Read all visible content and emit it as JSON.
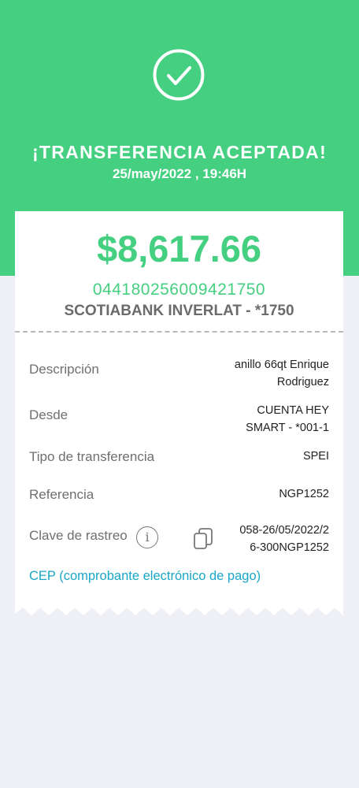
{
  "header": {
    "title": "¡TRANSFERENCIA ACEPTADA!",
    "datetime": "25/may/2022 , 19:46H",
    "icon": "check-circle-icon",
    "background_color": "#45cf80"
  },
  "receipt": {
    "amount": "$8,617.66",
    "account_number": "044180256009421750",
    "bank": "SCOTIABANK INVERLAT - *1750",
    "details": [
      {
        "label": "Descripción",
        "value_lines": [
          "anillo 66qt Enrique",
          "Rodriguez"
        ]
      },
      {
        "label": "Desde",
        "value_lines": [
          "CUENTA HEY",
          "SMART - *001-1"
        ]
      },
      {
        "label": "Tipo de transferencia",
        "value_lines": [
          "SPEI"
        ]
      },
      {
        "label": "Referencia",
        "value_lines": [
          "NGP1252"
        ]
      },
      {
        "label": "Clave de rastreo",
        "value_lines": [
          "058-26/05/2022/2",
          "6-300NGP1252"
        ]
      }
    ],
    "info_icon": "info-icon",
    "copy_icon": "copy-icon",
    "cep_link": "CEP (comprobante electrónico de pago)",
    "accent_color": "#45cf80",
    "link_color": "#1aa6c4"
  }
}
